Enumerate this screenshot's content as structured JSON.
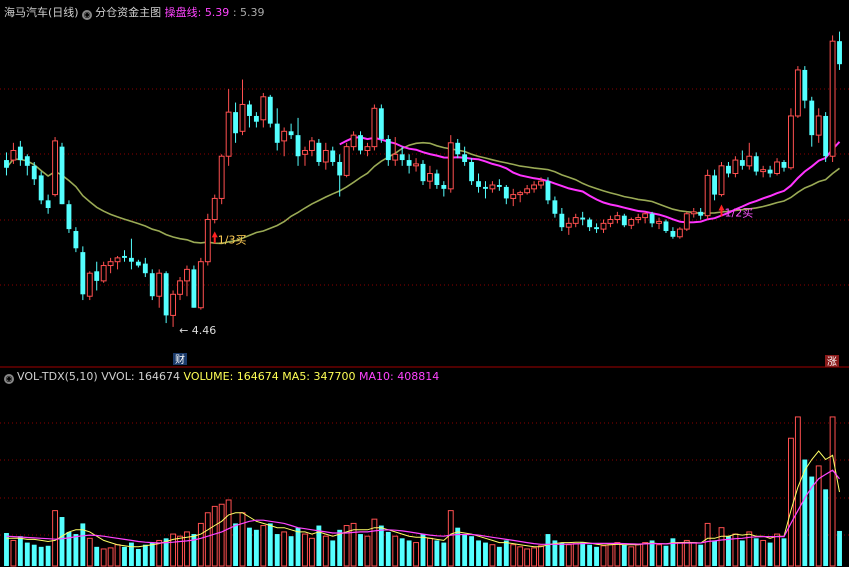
{
  "header": {
    "stock_name": "海马汽车(日线)",
    "main_chart_label": "分仓资金主图",
    "indicator_label": "操盘线:",
    "indicator_value1": "5.39",
    "indicator_value2": ": 5.39"
  },
  "volume_header": {
    "name": "VOL-TDX(5,10)",
    "vvol": "VVOL: 164674",
    "volume": "VOLUME: 164674",
    "ma5": "MA5: 347700",
    "ma10": "MA10: 408814"
  },
  "annotations": {
    "low_price": "4.46",
    "buy1": "1/3买",
    "buy2": "1/2买",
    "cai_badge": "财",
    "zhang_badge": "涨"
  },
  "colors": {
    "up": "#ff5050",
    "down": "#54ffff",
    "ma_long": "#9aaa55",
    "operating_line": "#ff33ff",
    "grid": "#8b0000",
    "vol_ma5": "#ffff66",
    "vol_ma10": "#ff44ff"
  },
  "chart_data": {
    "type": "candlestick",
    "price_panel": {
      "ohlc": [
        [
          5.33,
          5.37,
          5.25,
          5.29
        ],
        [
          5.33,
          5.42,
          5.31,
          5.38
        ],
        [
          5.4,
          5.43,
          5.3,
          5.33
        ],
        [
          5.35,
          5.36,
          5.25,
          5.3
        ],
        [
          5.3,
          5.32,
          5.2,
          5.23
        ],
        [
          5.25,
          5.27,
          5.1,
          5.12
        ],
        [
          5.12,
          5.15,
          5.05,
          5.08
        ],
        [
          5.15,
          5.45,
          5.14,
          5.43
        ],
        [
          5.4,
          5.42,
          5.1,
          5.1
        ],
        [
          5.1,
          5.12,
          4.95,
          4.97
        ],
        [
          4.96,
          4.98,
          4.85,
          4.87
        ],
        [
          4.85,
          4.88,
          4.6,
          4.63
        ],
        [
          4.62,
          4.75,
          4.6,
          4.74
        ],
        [
          4.75,
          4.8,
          4.65,
          4.7
        ],
        [
          4.7,
          4.8,
          4.69,
          4.78
        ],
        [
          4.78,
          4.82,
          4.74,
          4.8
        ],
        [
          4.8,
          4.83,
          4.76,
          4.82
        ],
        [
          4.83,
          4.86,
          4.8,
          4.82
        ],
        [
          4.82,
          4.92,
          4.76,
          4.8
        ],
        [
          4.8,
          4.81,
          4.77,
          4.78
        ],
        [
          4.79,
          4.82,
          4.72,
          4.74
        ],
        [
          4.74,
          4.76,
          4.6,
          4.62
        ],
        [
          4.62,
          4.76,
          4.56,
          4.74
        ],
        [
          4.74,
          4.75,
          4.48,
          4.52
        ],
        [
          4.52,
          4.65,
          4.46,
          4.63
        ],
        [
          4.63,
          4.72,
          4.6,
          4.7
        ],
        [
          4.7,
          4.78,
          4.62,
          4.76
        ],
        [
          4.76,
          4.78,
          4.56,
          4.56
        ],
        [
          4.56,
          4.82,
          4.55,
          4.8
        ],
        [
          4.8,
          5.05,
          4.78,
          5.02
        ],
        [
          5.02,
          5.15,
          5.0,
          5.13
        ],
        [
          5.13,
          5.36,
          5.1,
          5.35
        ],
        [
          5.35,
          5.7,
          5.3,
          5.58
        ],
        [
          5.58,
          5.63,
          5.42,
          5.47
        ],
        [
          5.48,
          5.75,
          5.46,
          5.62
        ],
        [
          5.62,
          5.64,
          5.5,
          5.56
        ],
        [
          5.56,
          5.58,
          5.5,
          5.53
        ],
        [
          5.54,
          5.68,
          5.5,
          5.66
        ],
        [
          5.66,
          5.67,
          5.5,
          5.52
        ],
        [
          5.52,
          5.6,
          5.38,
          5.42
        ],
        [
          5.43,
          5.5,
          5.35,
          5.48
        ],
        [
          5.48,
          5.52,
          5.44,
          5.46
        ],
        [
          5.46,
          5.55,
          5.3,
          5.35
        ],
        [
          5.36,
          5.4,
          5.3,
          5.38
        ],
        [
          5.38,
          5.45,
          5.35,
          5.43
        ],
        [
          5.42,
          5.44,
          5.3,
          5.32
        ],
        [
          5.32,
          5.42,
          5.28,
          5.38
        ],
        [
          5.38,
          5.4,
          5.3,
          5.32
        ],
        [
          5.32,
          5.36,
          5.14,
          5.25
        ],
        [
          5.25,
          5.42,
          5.24,
          5.4
        ],
        [
          5.4,
          5.48,
          5.38,
          5.46
        ],
        [
          5.46,
          5.48,
          5.36,
          5.38
        ],
        [
          5.38,
          5.42,
          5.35,
          5.4
        ],
        [
          5.4,
          5.62,
          5.38,
          5.6
        ],
        [
          5.6,
          5.62,
          5.42,
          5.44
        ],
        [
          5.44,
          5.46,
          5.3,
          5.33
        ],
        [
          5.33,
          5.45,
          5.3,
          5.36
        ],
        [
          5.36,
          5.4,
          5.3,
          5.33
        ],
        [
          5.33,
          5.36,
          5.26,
          5.3
        ],
        [
          5.3,
          5.34,
          5.27,
          5.31
        ],
        [
          5.31,
          5.33,
          5.2,
          5.22
        ],
        [
          5.22,
          5.3,
          5.18,
          5.26
        ],
        [
          5.26,
          5.28,
          5.18,
          5.2
        ],
        [
          5.2,
          5.22,
          5.14,
          5.18
        ],
        [
          5.18,
          5.46,
          5.16,
          5.42
        ],
        [
          5.42,
          5.44,
          5.34,
          5.36
        ],
        [
          5.36,
          5.4,
          5.3,
          5.32
        ],
        [
          5.32,
          5.34,
          5.2,
          5.22
        ],
        [
          5.22,
          5.26,
          5.16,
          5.19
        ],
        [
          5.19,
          5.22,
          5.13,
          5.18
        ],
        [
          5.18,
          5.22,
          5.16,
          5.2
        ],
        [
          5.2,
          5.23,
          5.17,
          5.19
        ],
        [
          5.19,
          5.2,
          5.1,
          5.13
        ],
        [
          5.13,
          5.18,
          5.09,
          5.15
        ],
        [
          5.15,
          5.17,
          5.11,
          5.16
        ],
        [
          5.16,
          5.2,
          5.15,
          5.18
        ],
        [
          5.18,
          5.22,
          5.16,
          5.2
        ],
        [
          5.2,
          5.24,
          5.18,
          5.22
        ],
        [
          5.22,
          5.24,
          5.1,
          5.12
        ],
        [
          5.12,
          5.14,
          5.03,
          5.05
        ],
        [
          5.05,
          5.08,
          4.96,
          4.98
        ],
        [
          4.98,
          5.03,
          4.94,
          5.0
        ],
        [
          5.0,
          5.05,
          4.98,
          5.03
        ],
        [
          5.03,
          5.06,
          4.99,
          5.02
        ],
        [
          5.02,
          5.03,
          4.96,
          4.98
        ],
        [
          4.98,
          5.0,
          4.95,
          4.97
        ],
        [
          4.97,
          5.02,
          4.95,
          5.0
        ],
        [
          5.0,
          5.04,
          4.98,
          5.02
        ],
        [
          5.02,
          5.06,
          5.0,
          5.04
        ],
        [
          5.04,
          5.05,
          4.98,
          4.99
        ],
        [
          4.99,
          5.03,
          4.97,
          5.02
        ],
        [
          5.02,
          5.05,
          5.0,
          5.03
        ],
        [
          5.03,
          5.06,
          5.0,
          5.05
        ],
        [
          5.05,
          5.06,
          4.98,
          5.0
        ],
        [
          5.0,
          5.03,
          4.97,
          5.01
        ],
        [
          5.01,
          5.02,
          4.95,
          4.96
        ],
        [
          4.96,
          4.98,
          4.92,
          4.93
        ],
        [
          4.93,
          4.98,
          4.92,
          4.97
        ],
        [
          4.97,
          5.06,
          4.96,
          5.05
        ],
        [
          5.05,
          5.08,
          5.03,
          5.06
        ],
        [
          5.06,
          5.08,
          5.02,
          5.04
        ],
        [
          5.04,
          5.28,
          5.02,
          5.25
        ],
        [
          5.25,
          5.28,
          5.12,
          5.15
        ],
        [
          5.15,
          5.32,
          5.14,
          5.3
        ],
        [
          5.3,
          5.32,
          5.24,
          5.26
        ],
        [
          5.26,
          5.35,
          5.24,
          5.33
        ],
        [
          5.33,
          5.38,
          5.28,
          5.3
        ],
        [
          5.3,
          5.42,
          5.28,
          5.35
        ],
        [
          5.35,
          5.37,
          5.25,
          5.27
        ],
        [
          5.27,
          5.3,
          5.24,
          5.28
        ],
        [
          5.28,
          5.3,
          5.24,
          5.26
        ],
        [
          5.26,
          5.34,
          5.25,
          5.32
        ],
        [
          5.32,
          5.33,
          5.27,
          5.29
        ],
        [
          5.29,
          5.6,
          5.28,
          5.56
        ],
        [
          5.56,
          5.82,
          5.55,
          5.8
        ],
        [
          5.8,
          5.82,
          5.6,
          5.64
        ],
        [
          5.64,
          5.66,
          5.4,
          5.46
        ],
        [
          5.46,
          5.6,
          5.42,
          5.56
        ],
        [
          5.56,
          5.58,
          5.32,
          5.35
        ],
        [
          5.35,
          5.98,
          5.32,
          5.95
        ],
        [
          5.95,
          6.0,
          5.8,
          5.83
        ]
      ],
      "ylim": [
        4.35,
        6.05
      ]
    },
    "volume_panel": {
      "volume": [
        155,
        120,
        140,
        110,
        100,
        90,
        95,
        260,
        230,
        160,
        150,
        200,
        130,
        90,
        80,
        85,
        100,
        90,
        110,
        80,
        100,
        110,
        120,
        130,
        150,
        140,
        160,
        150,
        200,
        250,
        280,
        290,
        310,
        200,
        250,
        180,
        170,
        190,
        200,
        150,
        160,
        140,
        180,
        150,
        130,
        190,
        140,
        120,
        170,
        190,
        200,
        150,
        140,
        220,
        190,
        160,
        140,
        130,
        120,
        110,
        150,
        130,
        120,
        110,
        260,
        180,
        150,
        140,
        120,
        110,
        100,
        90,
        120,
        100,
        90,
        80,
        85,
        95,
        150,
        120,
        110,
        100,
        105,
        110,
        100,
        90,
        95,
        100,
        110,
        100,
        90,
        100,
        110,
        120,
        100,
        95,
        130,
        110,
        120,
        110,
        100,
        200,
        120,
        180,
        140,
        150,
        120,
        160,
        130,
        120,
        110,
        150,
        130,
        600,
        700,
        500,
        420,
        470,
        360,
        700,
        164.674
      ],
      "ma5": [
        130,
        130,
        130,
        125,
        125,
        120,
        115,
        120,
        140,
        160,
        170,
        170,
        160,
        140,
        120,
        110,
        100,
        95,
        90,
        90,
        95,
        100,
        105,
        115,
        125,
        130,
        135,
        140,
        150,
        170,
        190,
        210,
        240,
        250,
        250,
        230,
        210,
        200,
        190,
        180,
        180,
        170,
        160,
        160,
        150,
        160,
        150,
        140,
        150,
        160,
        170,
        170,
        170,
        180,
        180,
        170,
        160,
        150,
        140,
        135,
        135,
        130,
        125,
        120,
        150,
        160,
        155,
        150,
        140,
        130,
        120,
        110,
        110,
        105,
        100,
        95,
        90,
        90,
        100,
        105,
        110,
        110,
        112,
        112,
        108,
        102,
        98,
        100,
        102,
        100,
        100,
        100,
        105,
        108,
        105,
        104,
        110,
        110,
        112,
        110,
        108,
        130,
        130,
        140,
        140,
        150,
        145,
        150,
        140,
        140,
        130,
        140,
        140,
        260,
        370,
        450,
        500,
        540,
        500,
        520,
        347.7
      ],
      "ma10": [
        140,
        138,
        136,
        134,
        132,
        130,
        128,
        126,
        128,
        132,
        138,
        142,
        145,
        143,
        140,
        135,
        130,
        125,
        120,
        115,
        112,
        110,
        108,
        110,
        112,
        115,
        118,
        122,
        130,
        140,
        150,
        160,
        175,
        190,
        200,
        210,
        215,
        215,
        210,
        205,
        200,
        190,
        180,
        175,
        170,
        165,
        160,
        155,
        155,
        155,
        158,
        160,
        160,
        165,
        168,
        170,
        168,
        165,
        160,
        155,
        150,
        145,
        142,
        140,
        145,
        148,
        148,
        148,
        145,
        140,
        135,
        130,
        125,
        120,
        115,
        110,
        105,
        102,
        102,
        102,
        102,
        103,
        104,
        105,
        106,
        106,
        106,
        106,
        106,
        105,
        104,
        103,
        104,
        105,
        105,
        104,
        106,
        107,
        108,
        108,
        108,
        115,
        118,
        122,
        125,
        128,
        130,
        135,
        137,
        138,
        138,
        138,
        138,
        200,
        260,
        320,
        370,
        410,
        430,
        450,
        408.814
      ],
      "ylim": [
        0,
        850
      ]
    }
  }
}
